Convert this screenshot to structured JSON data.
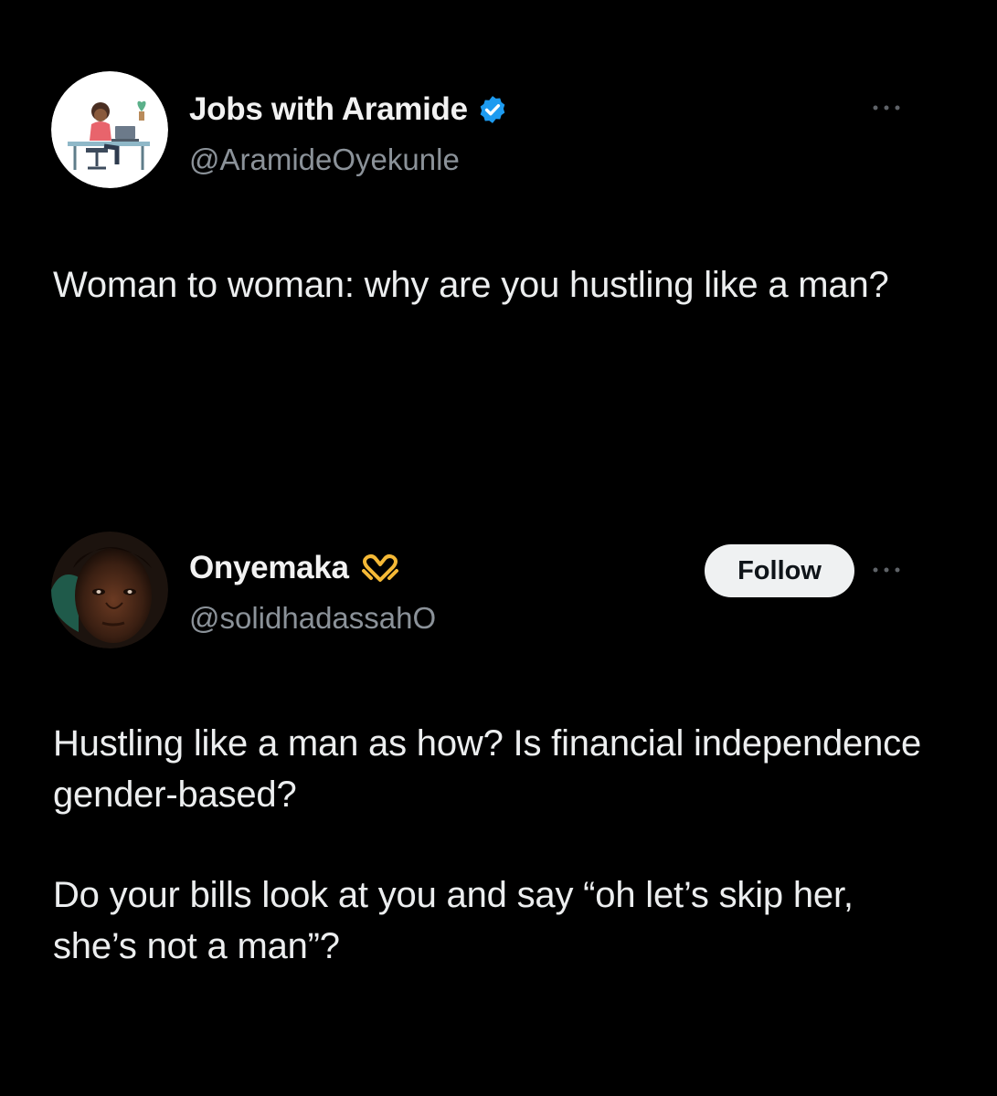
{
  "tweets": [
    {
      "author": {
        "display_name": "Jobs with Aramide",
        "handle": "@AramideOyekunle",
        "verified_icon": "verified-badge-icon",
        "avatar_icon": "woman-at-desk-illustration"
      },
      "text": [
        "Woman to woman: why are you hustling like a man?"
      ],
      "more_icon": "more-options-icon"
    },
    {
      "author": {
        "display_name": "Onyemaka",
        "handle": "@solidhadassahO",
        "name_emoji_icon": "heart-hands-emoji-icon",
        "avatar_icon": "profile-photo"
      },
      "follow_label": "Follow",
      "text": [
        "Hustling like a man as how? Is financial independence gender-based?",
        "Do your bills look at you and say “oh let’s skip her, she’s not a man”?"
      ],
      "more_icon": "more-options-icon"
    }
  ],
  "colors": {
    "background": "#000000",
    "text": "#e7e9ea",
    "secondary_text": "#8b9299",
    "verified_blue": "#1d9bf0",
    "follow_bg": "#eff1f2",
    "heart_hands": "#f5b936"
  }
}
